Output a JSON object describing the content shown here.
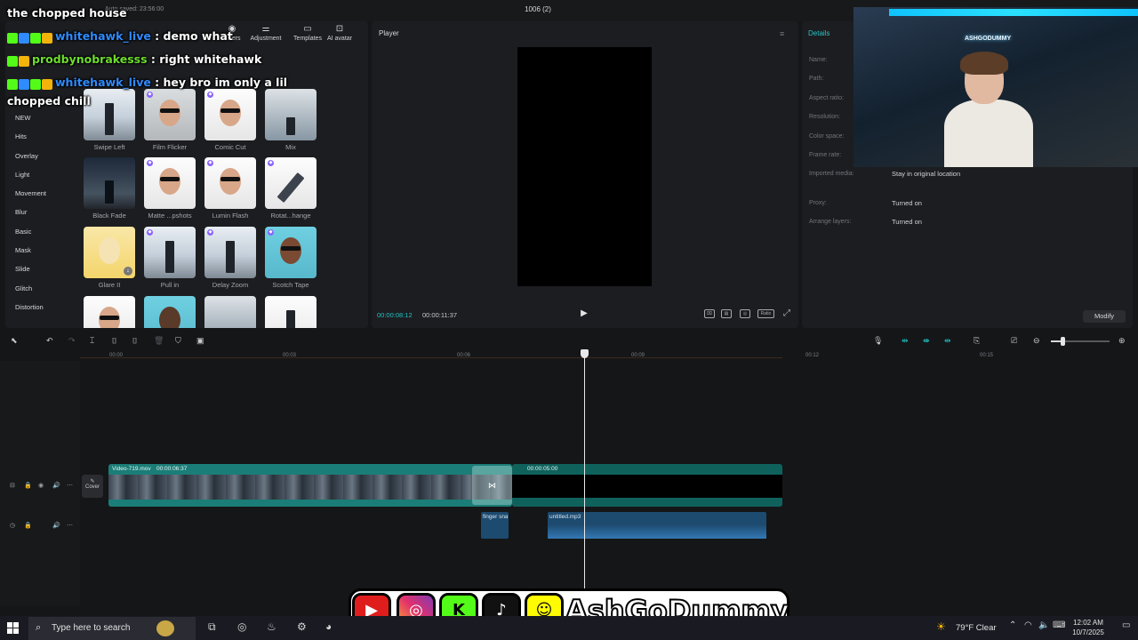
{
  "window": {
    "project_title": "1006 (2)",
    "autosave": "Auto saved: 23:56:00"
  },
  "toolbar": {
    "items": [
      "Filters",
      "Adjustment",
      "Templates",
      "AI avatar"
    ]
  },
  "effect_categories": [
    "NEW",
    "Hits",
    "Overlay",
    "Light",
    "Movement",
    "Blur",
    "Basic",
    "Mask",
    "Slide",
    "Glitch",
    "Distortion"
  ],
  "effects": [
    {
      "label": "Swipe Left"
    },
    {
      "label": "Film Flicker"
    },
    {
      "label": "Comic Cut"
    },
    {
      "label": "Mix"
    },
    {
      "label": "Black Fade"
    },
    {
      "label": "Matte ...pshots"
    },
    {
      "label": "Lumin Flash"
    },
    {
      "label": "Rotat...hange"
    },
    {
      "label": "Glare II"
    },
    {
      "label": "Pull in"
    },
    {
      "label": "Delay Zoom"
    },
    {
      "label": "Scotch Tape"
    },
    {
      "label": ""
    },
    {
      "label": ""
    },
    {
      "label": ""
    },
    {
      "label": ""
    }
  ],
  "player": {
    "title": "Player",
    "current_time": "00:00:08:12",
    "total_time": "00:00:11:37",
    "controls": [
      "Ratio"
    ]
  },
  "details": {
    "title": "Details",
    "fields": [
      {
        "label": "Name:",
        "value": ""
      },
      {
        "label": "Path:",
        "value": ""
      },
      {
        "label": "Aspect ratio:",
        "value": ""
      },
      {
        "label": "Resolution:",
        "value": ""
      },
      {
        "label": "Color space:",
        "value": ""
      },
      {
        "label": "Frame rate:",
        "value": ""
      },
      {
        "label": "Imported media:",
        "value": "Stay in original location"
      },
      {
        "label": "Proxy:",
        "value": "Turned on"
      },
      {
        "label": "Arrange layers:",
        "value": "Turned on"
      }
    ],
    "modify_label": "Modify"
  },
  "timeline": {
    "ruler": [
      "00:00",
      "00:03",
      "00:06",
      "00:09",
      "00:12",
      "00:15"
    ],
    "cover_label": "Cover",
    "video_clip": {
      "name": "Video-719.mov",
      "duration": "00:00:06:37"
    },
    "black_clip": {
      "duration": "00:00:05:00"
    },
    "audio_clips": [
      {
        "name": "finger sna"
      },
      {
        "name": "untitled.mp3"
      }
    ]
  },
  "chat": {
    "header": "the chopped house",
    "messages": [
      {
        "user": "whitehawk_live",
        "text": "demo what"
      },
      {
        "user": "prodbynobrakesss",
        "text": "right whitehawk"
      },
      {
        "user": "whitehawk_live",
        "text": "hey bro im only a lil"
      }
    ],
    "continuation": "chopped chill"
  },
  "webcam": {
    "neon_sign": "ASHGODUMMY"
  },
  "brand": {
    "name": "AshGoDummy",
    "accent": "#27c4c6"
  },
  "taskbar": {
    "search_placeholder": "Type here to search",
    "weather": "79°F  Clear",
    "time": "12:02 AM",
    "date": "10/7/2025"
  }
}
